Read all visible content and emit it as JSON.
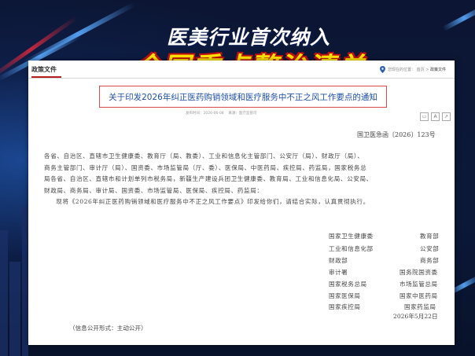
{
  "overlay": {
    "headline_line1": "医美行业首次纳入",
    "headline_line2": "全国重点整治清单"
  },
  "page": {
    "section": "政策文件",
    "location_label": "您现在的位置：",
    "breadcrumb": [
      "首页",
      "政策文件"
    ],
    "breadcrumb_sep": " > ",
    "title": "关于印发2026年纠正医药购销领域和医疗服务中不正之风工作要点的通知",
    "publish_date": "发布时间：2026-06-08",
    "source": "来源：医疗监管司",
    "tool_icons": [
      "print-icon",
      "font-size-icon",
      "share-icon"
    ]
  },
  "document": {
    "doc_number": "国卫医急函〔2026〕123号",
    "recipients_lines": [
      "各省、自治区、直辖市卫生健康委、教育厅（局、教委）、工业和信息化主管部门、公安厅（局）、财政厅（局）、",
      "商务主管部门、审计厅（局）、国资委、市场监管局（厅、委）、医保局、中医药局、疾控局、药监局，国家税务总",
      "局各省、自治区、直辖市和计划单列市税务局，新疆生产建设兵团卫生健康委、教育局、工业和信息化局、公安局、",
      "财政局、商务局、审计局、国资委、市场监管局、医保局、疾控局、药监局："
    ],
    "body": "现将《2026年纠正医药购销领域和医疗服务中不正之风工作要点》印发给你们，请结合实际，认真贯彻执行。",
    "signatories": [
      [
        "国家卫生健康委",
        "教育部"
      ],
      [
        "工业和信息化部",
        "公安部"
      ],
      [
        "财政部",
        "商务部"
      ],
      [
        "审计署",
        "国务院国资委"
      ],
      [
        "国家税务总局",
        "市场监管总局"
      ],
      [
        "国家医保局",
        "国家中医药局"
      ],
      [
        "国家疾控局",
        "国家药监局"
      ]
    ],
    "date": "2026年5月22日",
    "disclosure": "（信息公开形式：主动公开）"
  },
  "colors": {
    "title_blue": "#1d4fa6",
    "title_border_red": "#d94a4a",
    "headline_yellow": "#ffe600",
    "headline_outline_red": "#c01010"
  }
}
